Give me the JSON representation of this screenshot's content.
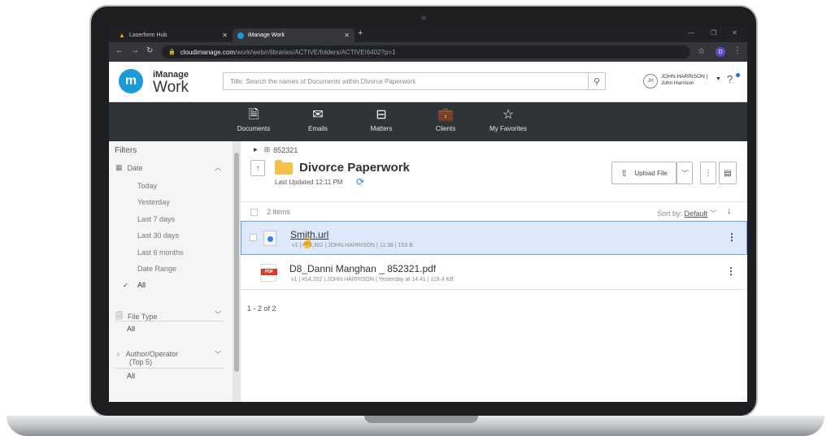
{
  "browser": {
    "tabs": [
      {
        "label": "Laserform Hub",
        "icon": "laserform-icon"
      },
      {
        "label": "iManage Work",
        "icon": "imanage-icon"
      }
    ],
    "address": {
      "host": "cloudimanage.com",
      "path": "/work/web/r/libraries/ACTIVE/folders/ACTIVE!6402?p=1"
    },
    "profile_initial": "D"
  },
  "header": {
    "logo_letter": "m",
    "logo_line1": "iManage",
    "logo_line2": "Work",
    "search_placeholder": "Title: Search the names of Documents within Divorce Paperwork",
    "avatar_initials": "JH",
    "user_line1": "JOHN.HARRISON |",
    "user_line2": "John Harrison",
    "help": "?"
  },
  "nav": {
    "items": [
      {
        "label": "Documents",
        "icon": "document-icon"
      },
      {
        "label": "Emails",
        "icon": "email-icon"
      },
      {
        "label": "Matters",
        "icon": "matters-icon"
      },
      {
        "label": "Clients",
        "icon": "briefcase-icon"
      },
      {
        "label": "My Favorites",
        "icon": "star-icon"
      }
    ]
  },
  "sidebar": {
    "title": "Filters",
    "date_label": "Date",
    "date_options": [
      "Today",
      "Yesterday",
      "Last 7 days",
      "Last 30 days",
      "Last 6 months",
      "Date Range",
      "All"
    ],
    "date_selected": "All",
    "filetype_label": "File Type",
    "filetype_value": "All",
    "author_label_1": "Author/Operator",
    "author_label_2": "(Top 5)",
    "author_value": "All"
  },
  "main": {
    "breadcrumb": "852321",
    "folder_title": "Divorce Paperwork",
    "last_updated": "Last Updated 12:11 PM",
    "upload_label": "Upload File",
    "items_count": "2 items",
    "sort_label": "Sort by:",
    "sort_value": "Default",
    "rows": [
      {
        "name": "Smith.url",
        "meta": "v1 | #14,302 | JOHN.HARRISON | 11:38 | 153 B",
        "type": "url"
      },
      {
        "name": "D8_Danni Manghan _ 852321.pdf",
        "meta": "v1 | #14,202 | JOHN.HARRISON | Yesterday at 14:41 | 119.4 KB",
        "type": "pdf"
      }
    ],
    "pager": "1 - 2 of 2",
    "pdf_badge": "PDF"
  }
}
